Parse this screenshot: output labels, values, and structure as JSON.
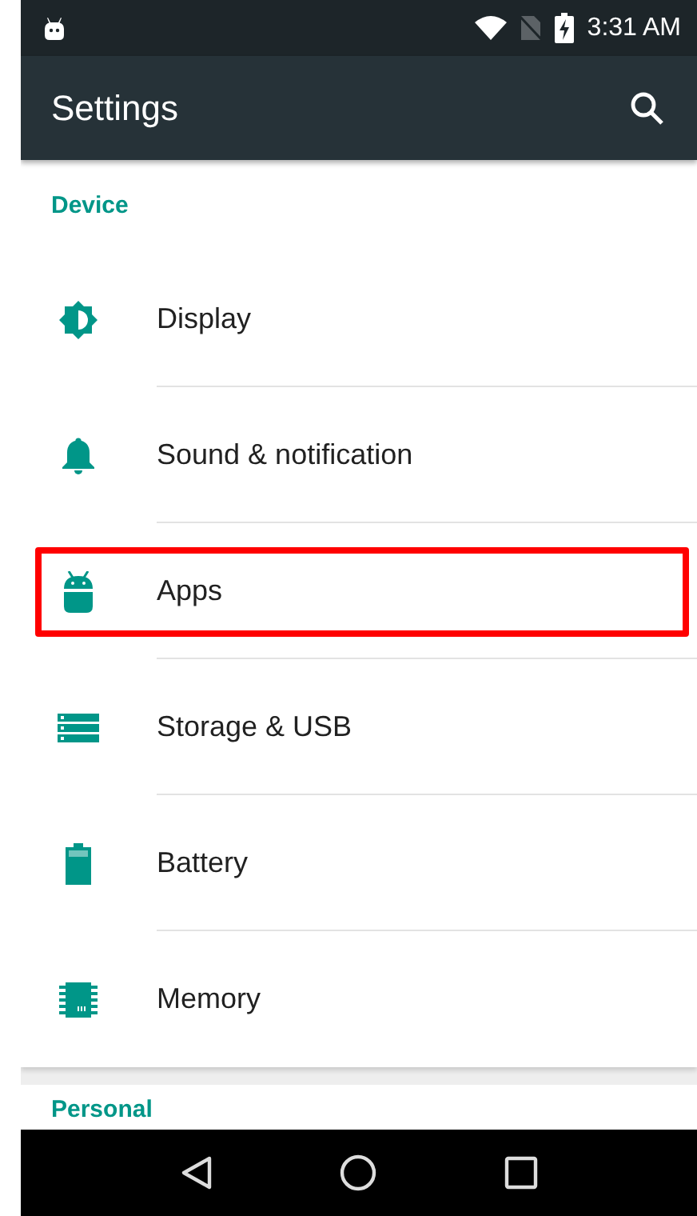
{
  "status_bar": {
    "time": "3:31 AM"
  },
  "app_bar": {
    "title": "Settings"
  },
  "sections": [
    {
      "header": "Device",
      "items": [
        {
          "label": "Display",
          "highlighted": false
        },
        {
          "label": "Sound & notification",
          "highlighted": false
        },
        {
          "label": "Apps",
          "highlighted": true
        },
        {
          "label": "Storage & USB",
          "highlighted": false
        },
        {
          "label": "Battery",
          "highlighted": false
        },
        {
          "label": "Memory",
          "highlighted": false
        }
      ]
    },
    {
      "header": "Personal"
    }
  ]
}
